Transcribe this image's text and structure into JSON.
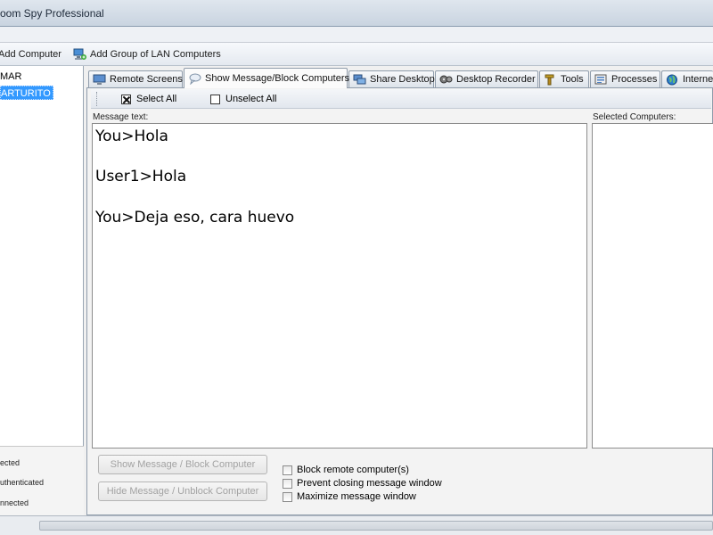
{
  "window": {
    "title": "oom Spy Professional"
  },
  "toolbar": {
    "add_computer": "Add Computer",
    "add_group": "Add Group of LAN Computers"
  },
  "computers": [
    {
      "label": "MAR",
      "selected": false
    },
    {
      "label": "ARTURITO",
      "selected": true
    }
  ],
  "status_legend": [
    "ected",
    "uthenticated",
    "nnected"
  ],
  "tabs": [
    {
      "label": "Remote Screens",
      "icon": "monitor-icon",
      "active": false
    },
    {
      "label": "Show Message/Block Computers",
      "icon": "speech-bubble-icon",
      "active": true
    },
    {
      "label": "Share Desktop",
      "icon": "share-desktop-icon",
      "active": false
    },
    {
      "label": "Desktop Recorder",
      "icon": "recorder-icon",
      "active": false
    },
    {
      "label": "Tools",
      "icon": "tools-icon",
      "active": false
    },
    {
      "label": "Processes",
      "icon": "processes-icon",
      "active": false
    },
    {
      "label": "Interne",
      "icon": "globe-icon",
      "active": false
    }
  ],
  "selection": {
    "select_all": "Select All",
    "unselect_all": "Unselect All"
  },
  "message": {
    "label": "Message text:",
    "lines": [
      "You>Hola",
      "User1>Hola",
      "You>Deja eso, cara huevo"
    ]
  },
  "selected_computers_label": "Selected Computers:",
  "buttons": {
    "show": "Show Message / Block Computer",
    "hide": "Hide Message / Unblock Computer"
  },
  "options": [
    {
      "label": "Block remote computer(s)",
      "checked": false
    },
    {
      "label": "Prevent closing message window",
      "checked": false
    },
    {
      "label": "Maximize message window",
      "checked": false
    }
  ],
  "colors": {
    "selection": "#3399ff",
    "disabled_text": "#a2a2a2"
  }
}
